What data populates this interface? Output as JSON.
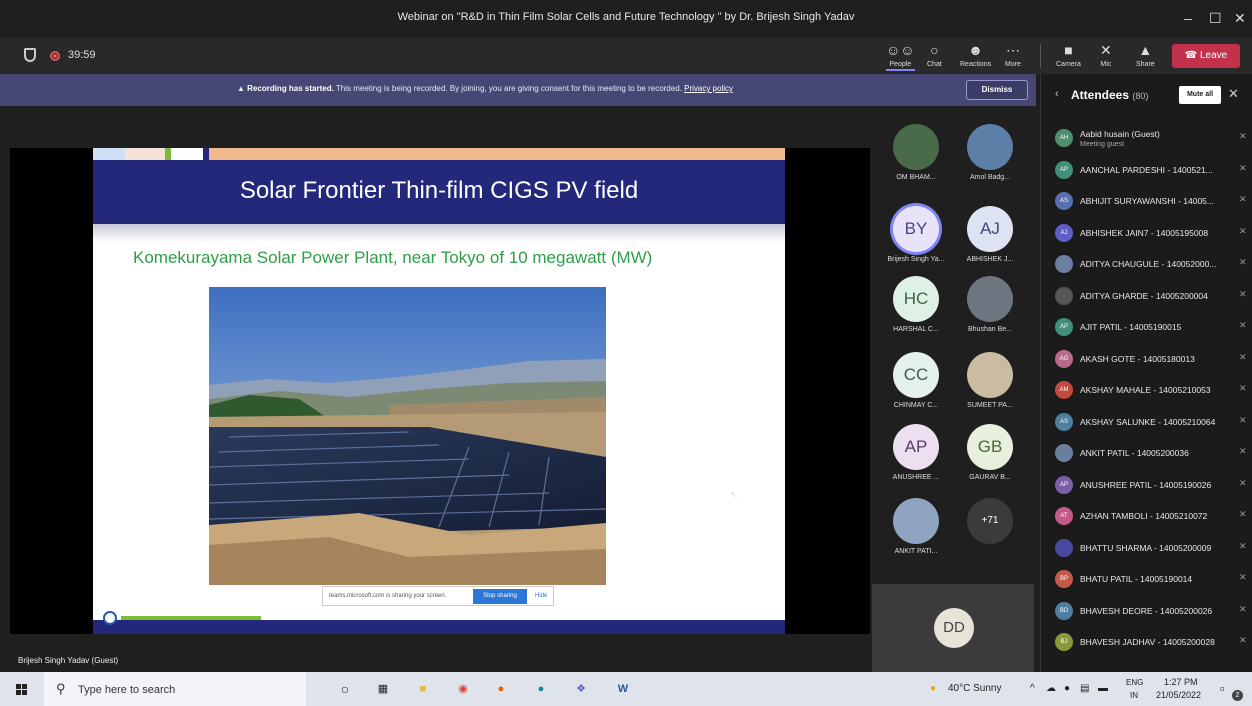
{
  "window": {
    "title": "Webinar on \"R&D in Thin Film Solar Cells and Future Technology \" by Dr. Brijesh Singh Yadav",
    "controls": [
      "–",
      "☐",
      "✕"
    ]
  },
  "toolbar": {
    "timer": "39:59",
    "buttons": [
      {
        "label": "People",
        "icon": "people-icon"
      },
      {
        "label": "Chat",
        "icon": "chat-icon"
      },
      {
        "label": "Reactions",
        "icon": "reactions-icon"
      },
      {
        "label": "More",
        "icon": "more-icon"
      },
      {
        "label": "Camera",
        "icon": "camera-off-icon"
      },
      {
        "label": "Mic",
        "icon": "mic-off-icon"
      },
      {
        "label": "Share",
        "icon": "share-icon"
      }
    ],
    "leave_label": "Leave",
    "accent": "#c4314b"
  },
  "banner": {
    "bold": "Recording has started.",
    "text": "This meeting is being recorded. By joining, you are giving consent for this meeting to be recorded.",
    "link": "Privacy policy",
    "dismiss_label": "Dismiss"
  },
  "slide": {
    "title": "Solar Frontier Thin-film CIGS PV field",
    "caption": "Komekurayama Solar Power Plant, near Tokyo of  10 megawatt (MW)",
    "share_text": "teams.microsoft.com is sharing your screen.",
    "stop_label": "Stop sharing",
    "hide_label": "Hide"
  },
  "presenter_label": "Brijesh Singh Yadav (Guest)",
  "participants": [
    {
      "initials": "",
      "name": "OM BHAM...",
      "photo": true,
      "color": "#4a6b4a"
    },
    {
      "initials": "",
      "name": "Amol Badg...",
      "photo": true,
      "color": "#5b7fa6"
    },
    {
      "initials": "BY",
      "name": "Brijesh Singh Ya...",
      "color": "#e8e3f8",
      "text": "#4b4585",
      "speaking": true
    },
    {
      "initials": "AJ",
      "name": "ABHISHEK J...",
      "color": "#dde3f3",
      "text": "#3c4d7a"
    },
    {
      "initials": "HC",
      "name": "HARSHAL C...",
      "color": "#dff0e4",
      "text": "#3a6446"
    },
    {
      "initials": "",
      "name": "Bhushan Be...",
      "photo": true,
      "color": "#6d7580"
    },
    {
      "initials": "CC",
      "name": "CHINMAY C...",
      "color": "#e4f1ed",
      "text": "#3a5b55"
    },
    {
      "initials": "",
      "name": "SUMEET PA...",
      "photo": true,
      "color": "#c9bca0"
    },
    {
      "initials": "AP",
      "name": "ANUSHREE ...",
      "color": "#ecdff0",
      "text": "#5b3c66"
    },
    {
      "initials": "GB",
      "name": "GAURAV B...",
      "color": "#e7f0dd",
      "text": "#4b6638"
    },
    {
      "initials": "",
      "name": "ANKIT PATI...",
      "photo": true,
      "color": "#8fa4c0"
    },
    {
      "initials": "+71",
      "name": "",
      "color": "#3b3b3b",
      "text": "#ffffff"
    }
  ],
  "dd_tile": {
    "initials": "DD"
  },
  "attendees": {
    "title": "Attendees",
    "count": "(80)",
    "mute_all_label": "Mute all",
    "list": [
      {
        "initials": "AH",
        "name": "Aabid husain (Guest)",
        "sub": "Meeting guest",
        "color": "#4f8f6f"
      },
      {
        "initials": "AP",
        "name": "AANCHAL PARDESHI - 1400521...",
        "color": "#3f8f7a"
      },
      {
        "initials": "AS",
        "name": "ABHIJIT SURYAWANSHI - 14005...",
        "color": "#5a6fb0"
      },
      {
        "initials": "AJ",
        "name": "ABHISHEK JAIN7 - 14005195008",
        "color": "#5b5fc7"
      },
      {
        "initials": "",
        "name": "ADITYA CHAUGULE - 140052000...",
        "color": "#6a7ea0"
      },
      {
        "initials": "",
        "name": "ADITYA GHARDE - 14005200004",
        "color": "#555555"
      },
      {
        "initials": "AP",
        "name": "AJIT PATIL - 14005190015",
        "color": "#3f8f7a"
      },
      {
        "initials": "AG",
        "name": "AKASH GOTE - 14005180013",
        "color": "#b86b8a"
      },
      {
        "initials": "AM",
        "name": "AKSHAY MAHALE - 14005210053",
        "color": "#c4493f"
      },
      {
        "initials": "AS",
        "name": "AKSHAY SALUNKE - 14005210064",
        "color": "#4f7fa0"
      },
      {
        "initials": "",
        "name": "ANKIT PATIL - 14005200036",
        "color": "#6a7ea0"
      },
      {
        "initials": "AP",
        "name": "ANUSHREE PATIL - 14005190026",
        "color": "#7a5fa8"
      },
      {
        "initials": "AT",
        "name": "AZHAN TAMBOLI - 14005210072",
        "color": "#c45a8a"
      },
      {
        "initials": "",
        "name": "BHATTU SHARMA - 14005200009",
        "color": "#4a4aa0"
      },
      {
        "initials": "BP",
        "name": "BHATU PATIL - 14005190014",
        "color": "#c45a4a"
      },
      {
        "initials": "BD",
        "name": "BHAVESH DEORE - 14005200026",
        "color": "#4f7fa0"
      },
      {
        "initials": "BJ",
        "name": "BHAVESH JADHAV - 14005200028",
        "color": "#8a9a3a"
      }
    ]
  },
  "taskbar": {
    "search_placeholder": "Type here to search",
    "weather": "40°C  Sunny",
    "lang_top": "ENG",
    "lang_bottom": "IN",
    "time": "1:27 PM",
    "date": "21/05/2022",
    "notification_count": "2"
  }
}
